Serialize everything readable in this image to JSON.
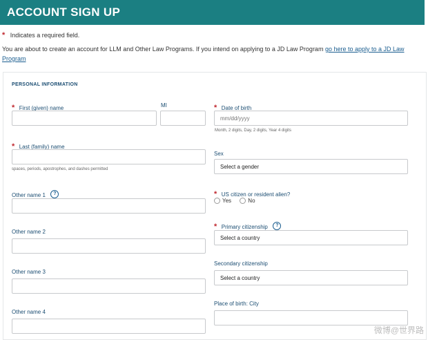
{
  "header": {
    "title": "ACCOUNT SIGN UP",
    "bg_color": "#1b7f82"
  },
  "required_note": {
    "star": "*",
    "text": "Indicates a required field."
  },
  "intro": {
    "text": "You are about to create an account for LLM and Other Law Programs. If you intend on applying to a JD Law Program ",
    "link": "go here to apply to a JD Law Program"
  },
  "section": {
    "title": "PERSONAL INFORMATION"
  },
  "fields": {
    "first_name": {
      "label": "First (given) name",
      "star": "*",
      "value": ""
    },
    "mi": {
      "label": "MI",
      "value": ""
    },
    "dob": {
      "label": "Date of birth",
      "star": "*",
      "placeholder": "mm/dd/yyyy",
      "hint": "Month, 2 digits, Day, 2 digits, Year 4 digits"
    },
    "last_name": {
      "label": "Last (family) name",
      "star": "*",
      "hint": "spaces, periods, apostrophes, and dashes permitted"
    },
    "sex": {
      "label": "Sex",
      "value": "Select a gender"
    },
    "other1": {
      "label": "Other name 1",
      "help": "?"
    },
    "us_citizen": {
      "label": "US citizen or resident alien?",
      "star": "*",
      "options": [
        "Yes",
        "No"
      ]
    },
    "primary_citizenship": {
      "label": "Primary citizenship",
      "star": "*",
      "help": "?",
      "value": "Select a country"
    },
    "other2": {
      "label": "Other name 2"
    },
    "secondary_citizenship": {
      "label": "Secondary citizenship",
      "value": "Select a country"
    },
    "other3": {
      "label": "Other name 3"
    },
    "birth_city": {
      "label": "Place of birth: City"
    },
    "other4": {
      "label": "Other name 4"
    }
  },
  "watermark": {
    "text": "微博@世界路"
  }
}
